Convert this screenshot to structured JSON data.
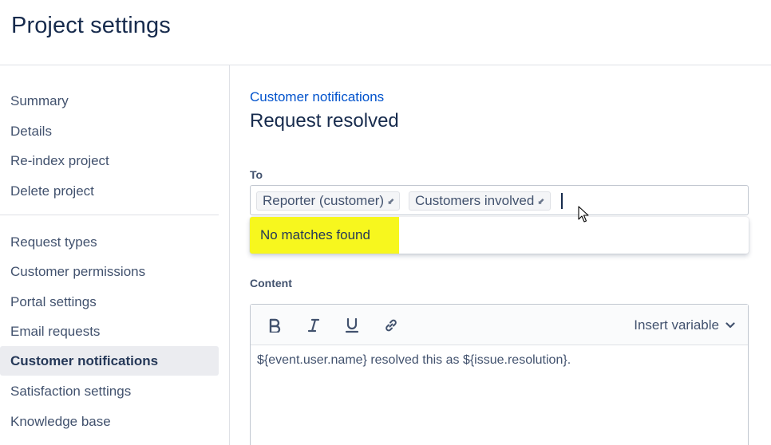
{
  "header": {
    "title": "Project settings"
  },
  "sidebar": {
    "items": [
      {
        "label": "Summary"
      },
      {
        "label": "Details"
      },
      {
        "label": "Re-index project"
      },
      {
        "label": "Delete project"
      },
      {
        "label": "Request types"
      },
      {
        "label": "Customer permissions"
      },
      {
        "label": "Portal settings"
      },
      {
        "label": "Email requests"
      },
      {
        "label": "Customer notifications",
        "active": true
      },
      {
        "label": "Satisfaction settings"
      },
      {
        "label": "Knowledge base"
      }
    ]
  },
  "main": {
    "breadcrumb": "Customer notifications",
    "title": "Request resolved",
    "to": {
      "label": "To",
      "chips": [
        {
          "label": "Reporter (customer)"
        },
        {
          "label": "Customers involved"
        }
      ],
      "dropdown_message": "No matches found"
    },
    "content": {
      "label": "Content",
      "toolbar": {
        "bold_icon": "bold-icon",
        "italic_icon": "italic-icon",
        "underline_icon": "underline-icon",
        "link_icon": "link-icon",
        "insert_variable": "Insert variable"
      },
      "body": "${event.user.name} resolved this as ${issue.resolution}."
    }
  },
  "colors": {
    "text": "#172b4d",
    "link": "#0052cc",
    "active_nav_bg": "#ebecf0",
    "highlight": "#f7f71e",
    "border": "#c1c7d0"
  }
}
